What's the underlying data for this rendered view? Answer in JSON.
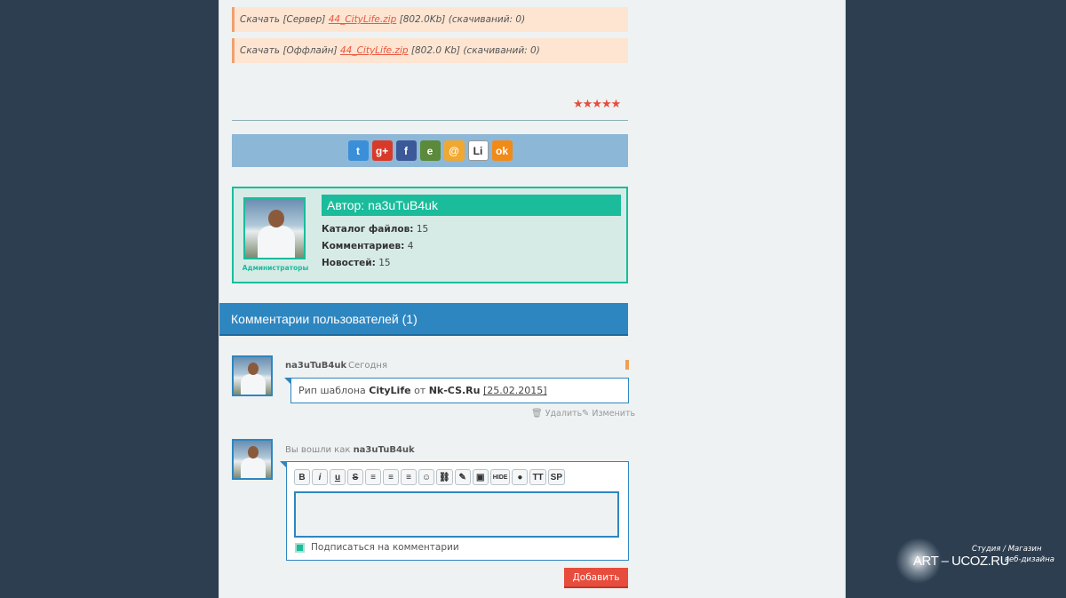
{
  "downloads": [
    {
      "prefix": "Скачать [Сервер]",
      "file": "44_CityLife.zip",
      "suffix": "[802.0Kb] (скачиваний: 0)"
    },
    {
      "prefix": "Скачать [Оффлайн]",
      "file": "44_CityLife.zip",
      "suffix": "[802.0 Kb] (скачиваний: 0)"
    }
  ],
  "rating": {
    "stars": 5,
    "display": "★★★★★"
  },
  "share": [
    {
      "name": "twitter-icon",
      "glyph": "t",
      "color": "#3b8fd8"
    },
    {
      "name": "google-plus-icon",
      "glyph": "g+",
      "color": "#d83a2a"
    },
    {
      "name": "facebook-icon",
      "glyph": "f",
      "color": "#3b5998"
    },
    {
      "name": "evernote-icon",
      "glyph": "e",
      "color": "#5a8a3a"
    },
    {
      "name": "mail-icon",
      "glyph": "@",
      "color": "#f0a830"
    },
    {
      "name": "liveinternet-icon",
      "glyph": "Li",
      "color": "#ffffff"
    },
    {
      "name": "odnoklassniki-icon",
      "glyph": "ok",
      "color": "#f28a18"
    }
  ],
  "author": {
    "title": "Автор: na3uTuB4uk",
    "role": "Администраторы",
    "stats": [
      {
        "label": "Каталог файлов:",
        "value": "15"
      },
      {
        "label": "Комментариев:",
        "value": "4"
      },
      {
        "label": "Новостей:",
        "value": "15"
      }
    ]
  },
  "comments": {
    "heading": "Комментарии пользователей (1)",
    "items": [
      {
        "user": "na3uTuB4uk",
        "date": "Сегодня",
        "text_pre": "Рип шаблона ",
        "text_b1": "CityLife",
        "text_mid": " от ",
        "text_b2": "Nk-CS.Ru",
        "text_date": "[25.02.2015]",
        "delete_label": "Удалить",
        "edit_label": "Изменить"
      }
    ]
  },
  "form": {
    "logged_as": "Вы вошли как",
    "user": "na3uTuB4uk",
    "toolbar": [
      "B",
      "i",
      "u",
      "S",
      "≡",
      "≡",
      "≡",
      "☺",
      "⛓",
      "✎",
      "▣",
      "HIDE",
      "●",
      "TT",
      "SP"
    ],
    "subscribe_label": "Подписаться на комментарии",
    "submit_label": "Добавить"
  },
  "watermark": {
    "brand": "ART – UCOZ.RU",
    "line1": "Студия / Магазин",
    "line2": "веб-дизайна"
  },
  "colors": {
    "accent": "#1abc9c",
    "header": "#2e86c1",
    "button": "#e74c3c",
    "background": "#2c3e50"
  }
}
